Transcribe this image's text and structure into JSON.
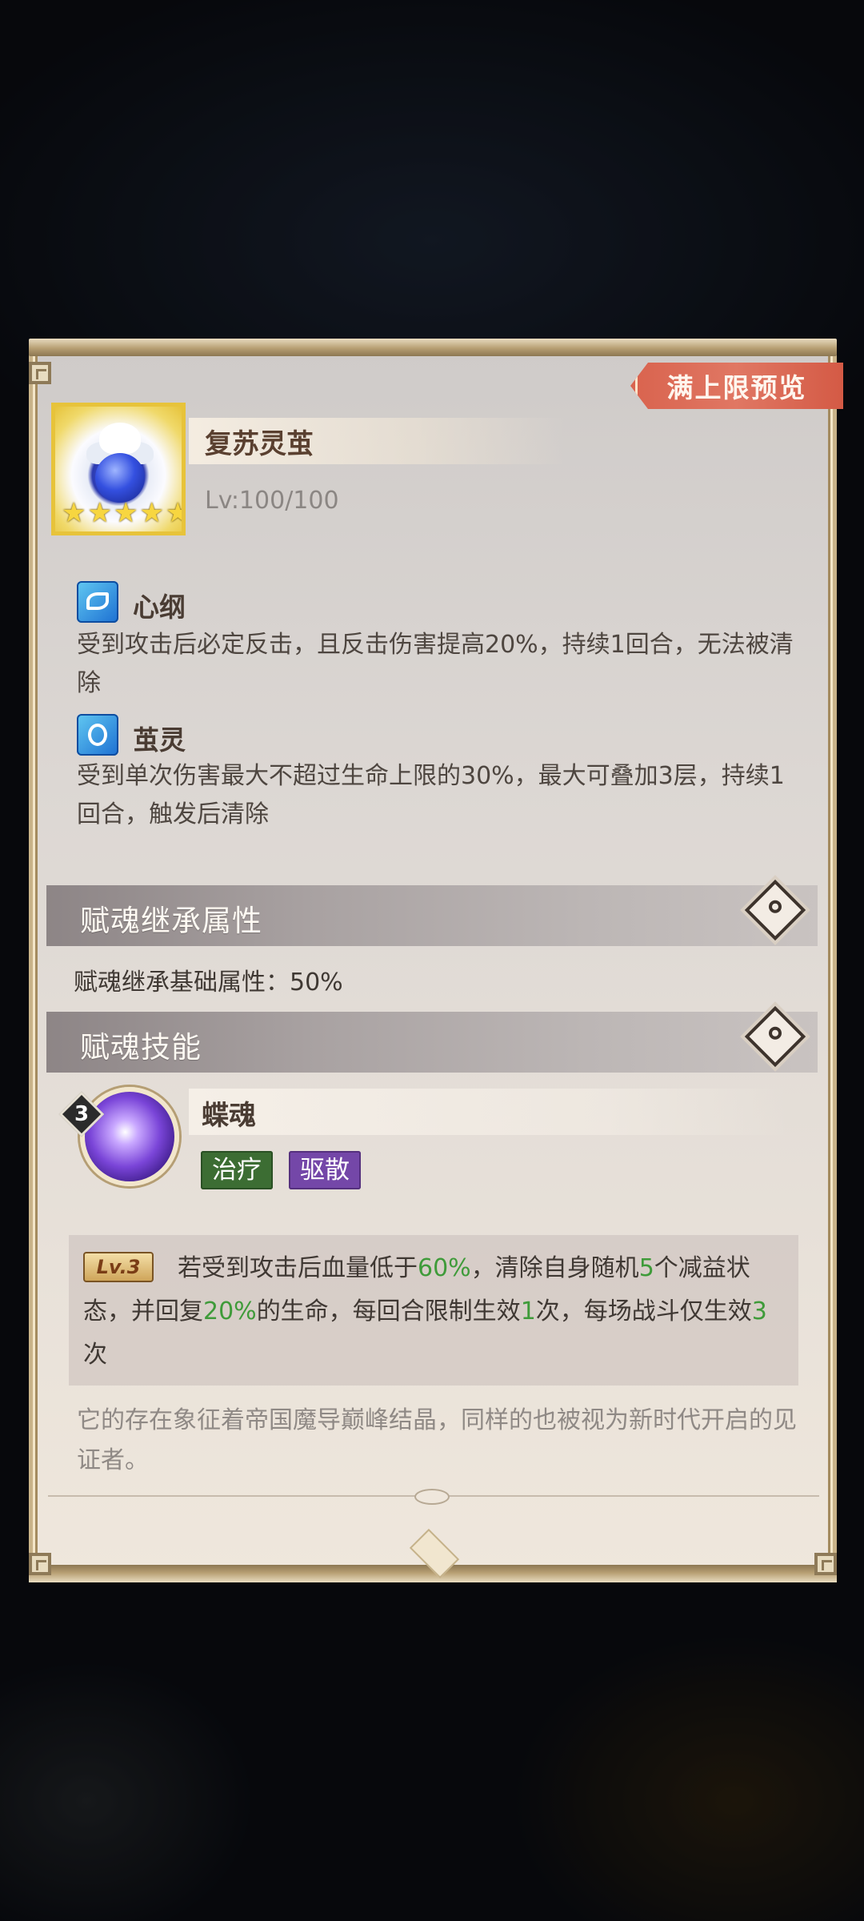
{
  "preview_button": "满上限预览",
  "item": {
    "name": "复苏灵茧",
    "level": "Lv:100/100",
    "stars": 5
  },
  "buffs": [
    {
      "icon": "feather-icon",
      "title": "心纲",
      "desc": "受到攻击后必定反击，且反击伤害提高20%，持续1回合，无法被清除"
    },
    {
      "icon": "cocoon-icon",
      "title": "茧灵",
      "desc": "受到单次伤害最大不超过生命上限的30%，最大可叠加3层，持续1回合，触发后清除"
    }
  ],
  "inherit_section": {
    "title": "赋魂继承属性",
    "text": "赋魂继承基础属性：50%"
  },
  "skill_section": {
    "title": "赋魂技能"
  },
  "skill": {
    "level_number": "3",
    "name": "蝶魂",
    "tags": [
      "治疗",
      "驱散"
    ],
    "lv_badge": "Lv.3",
    "desc_parts": [
      "若受到攻击后血量低于",
      "60%",
      "，清除自身随机",
      "5",
      "个减益状态，并回复",
      "20%",
      "的生命，每回合限制生效",
      "1",
      "次，每场战斗仅生效",
      "3",
      "次"
    ],
    "lore": "它的存在象征着帝国魔导巅峰结晶，同样的也被视为新时代开启的见证者。"
  },
  "colors": {
    "highlight": "#3f9b3a",
    "preview_button": "#e07763",
    "tag_heal": "#3c6d33",
    "tag_dispel": "#7447a8"
  }
}
